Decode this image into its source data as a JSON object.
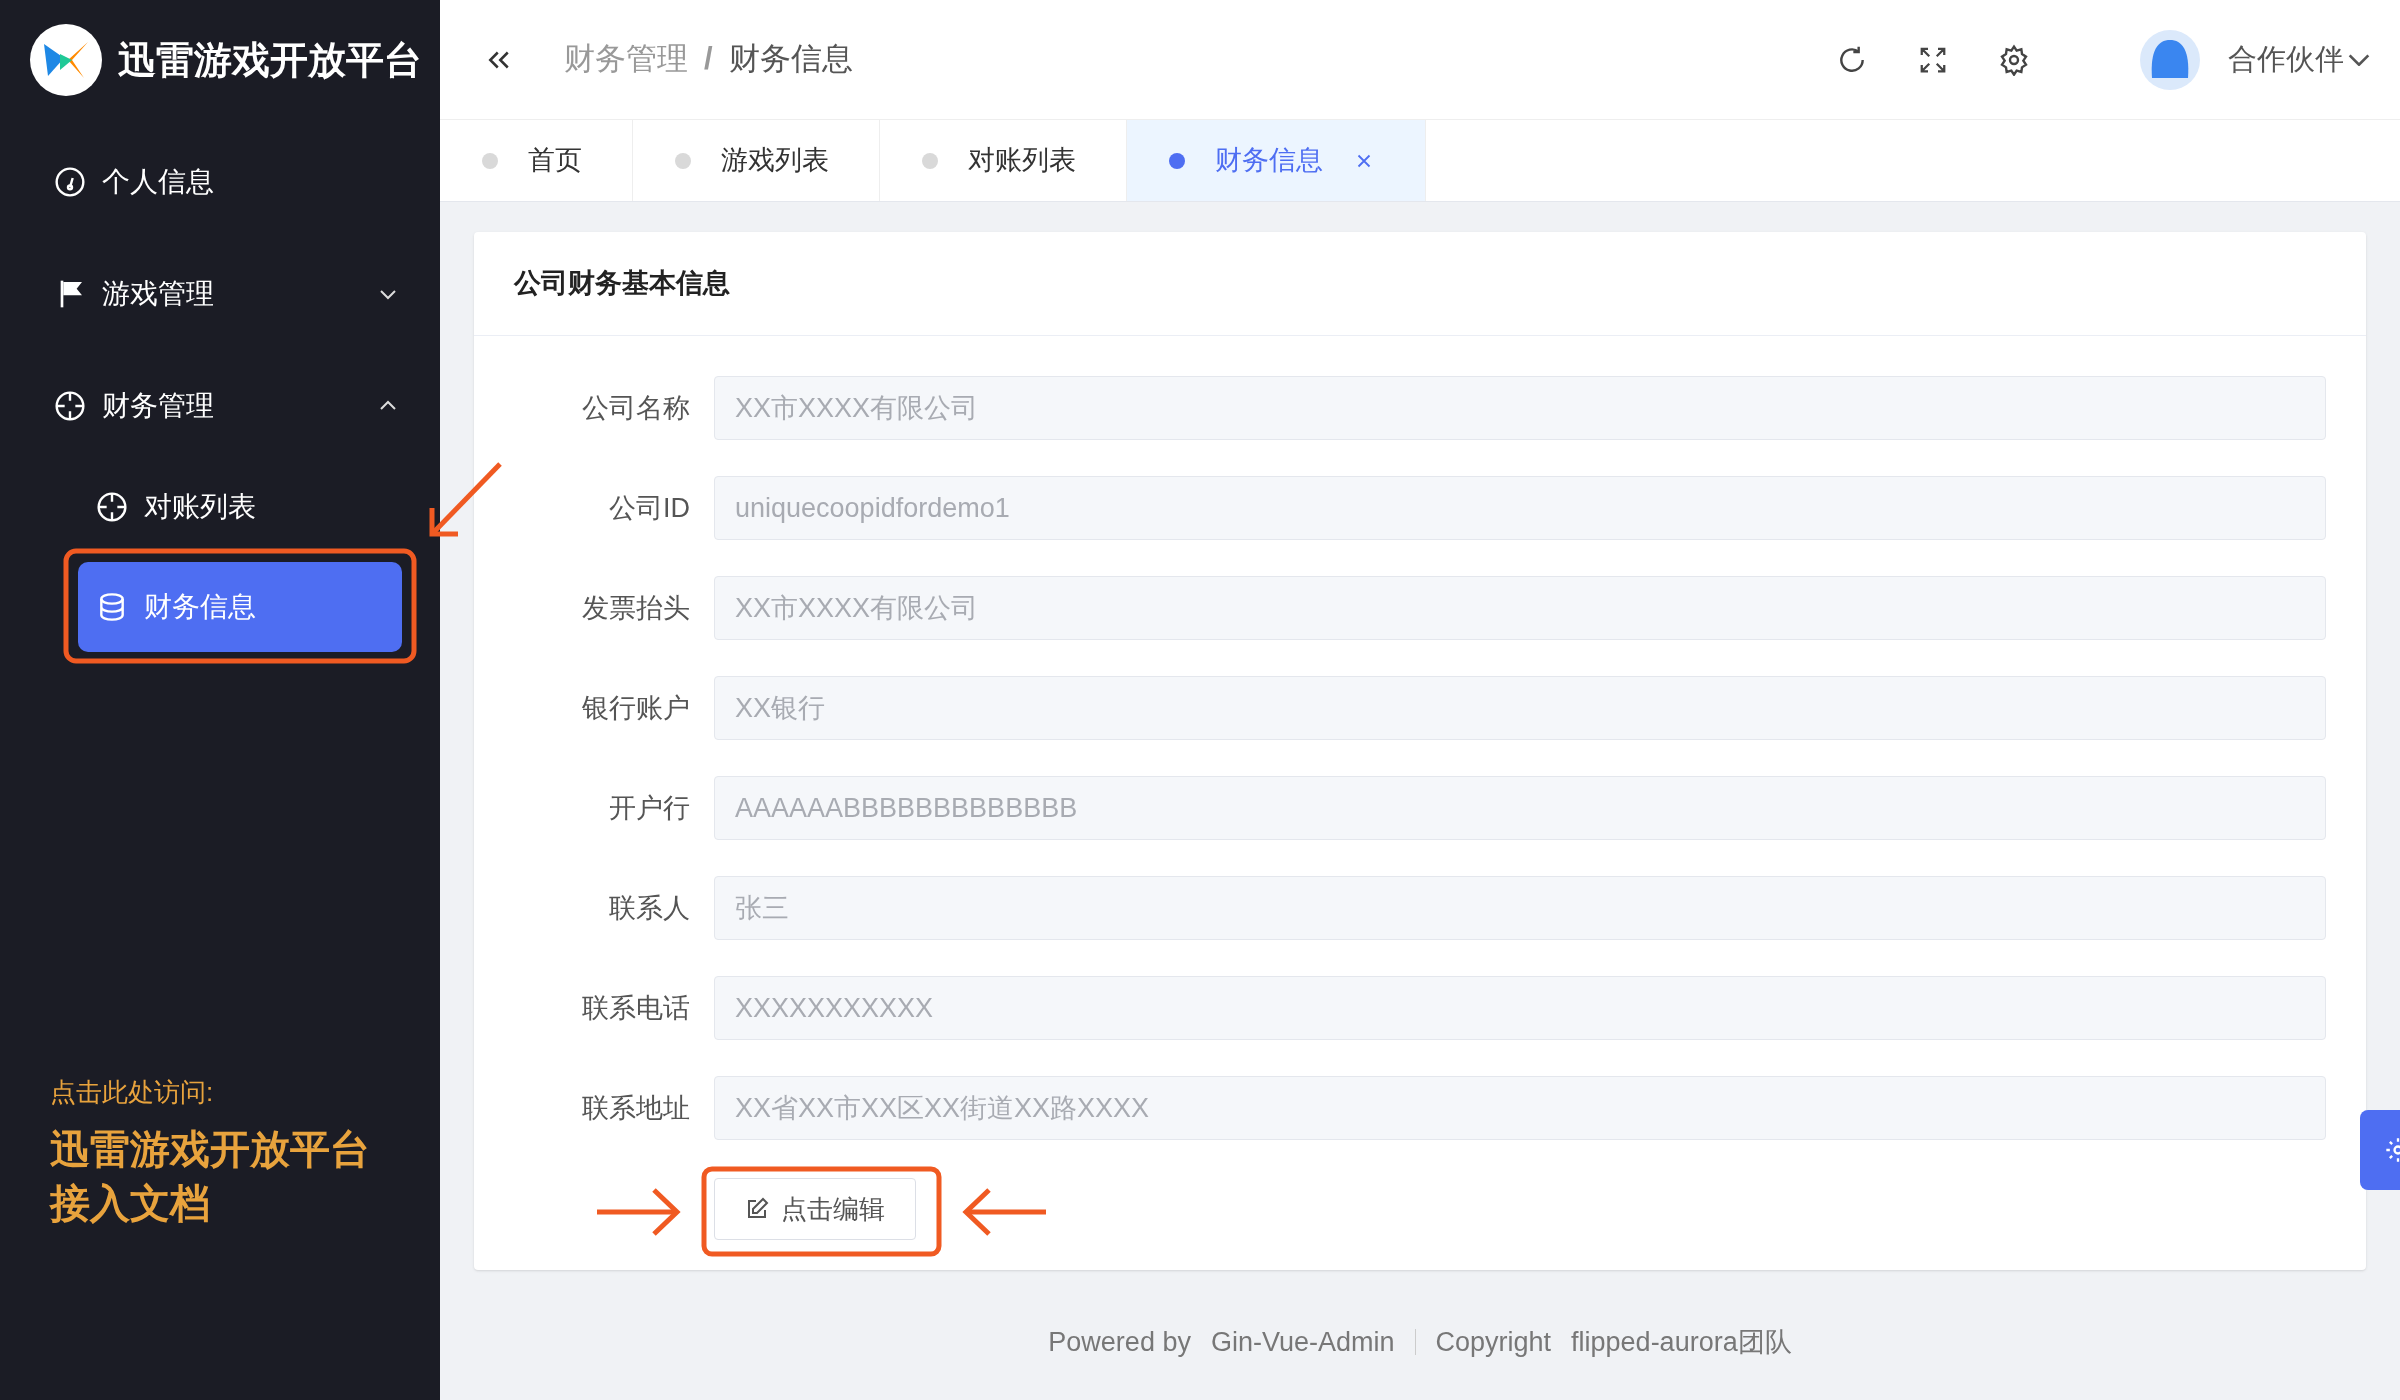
{
  "sidebar": {
    "title": "迅雷游戏开放平台",
    "items": [
      {
        "label": "个人信息",
        "selected": false
      },
      {
        "label": "游戏管理",
        "selected": false,
        "expanded": false
      },
      {
        "label": "财务管理",
        "selected": false,
        "expanded": true,
        "children": [
          {
            "label": "对账列表",
            "selected": false
          },
          {
            "label": "财务信息",
            "selected": true
          }
        ]
      }
    ],
    "promo": {
      "caption": "点击此处访问:",
      "link": "迅雷游戏开放平台接入文档"
    }
  },
  "header": {
    "breadcrumb": [
      "财务管理",
      "财务信息"
    ],
    "breadcrumb_separator": "/",
    "user": "合作伙伴"
  },
  "tabs": [
    {
      "label": "首页",
      "selected": false
    },
    {
      "label": "游戏列表",
      "selected": false
    },
    {
      "label": "对账列表",
      "selected": false
    },
    {
      "label": "财务信息",
      "selected": true
    }
  ],
  "card": {
    "title": "公司财务基本信息",
    "fields": [
      {
        "label": "公司名称",
        "value": "XX市XXXX有限公司",
        "disabled": true
      },
      {
        "label": "公司ID",
        "value": "uniquecoopidfordemo1",
        "disabled": true
      },
      {
        "label": "发票抬头",
        "value": "XX市XXXX有限公司",
        "disabled": true
      },
      {
        "label": "银行账户",
        "value": "XX银行",
        "disabled": true
      },
      {
        "label": "开户行",
        "value": "AAAAAABBBBBBBBBBBBB",
        "disabled": true
      },
      {
        "label": "联系人",
        "value": "张三",
        "disabled": true
      },
      {
        "label": "联系电话",
        "value": "XXXXXXXXXXX",
        "disabled": true
      },
      {
        "label": "联系地址",
        "value": "XX省XX市XX区XX街道XX路XXXX",
        "disabled": true
      }
    ],
    "button": "点击编辑"
  },
  "footer": {
    "powered_by": "Powered by",
    "powered_name": "Gin-Vue-Admin",
    "copyright": "Copyright",
    "copyright_name": "flipped-aurora团队"
  }
}
